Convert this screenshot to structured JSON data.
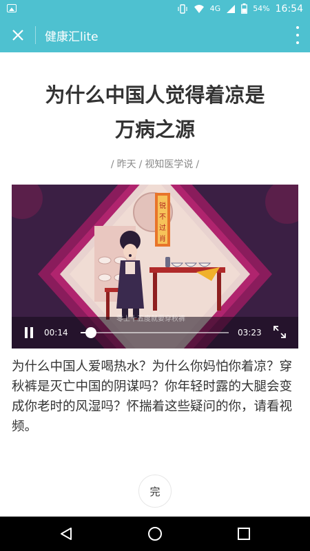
{
  "status_bar": {
    "network": "4G",
    "battery_percent": "54%",
    "time": "16:54"
  },
  "app_bar": {
    "title": "健康汇lite",
    "close_icon": "close-icon",
    "more_icon": "more-vert-icon"
  },
  "article": {
    "title_line1": "为什么中国人觉得着凉是",
    "title_line2": "万病之源",
    "meta_date": "昨天",
    "meta_source": "视知医学说",
    "meta_sep": "/",
    "body": "为什么中国人爱喝热水？为什么你妈怕你着凉？穿秋裤是灭亡中国的阴谋吗？你年轻时露的大腿会变成你老时的风湿吗？怀揣着这些疑问的你，请看视频。"
  },
  "video": {
    "banner_text": "锐不过肖",
    "subtitle": "零上十五度就要穿秋裤",
    "current_time": "00:14",
    "duration": "03:23",
    "progress": 0.07
  },
  "done_label": "完",
  "colors": {
    "accent": "#4ec1d0",
    "video_bg": "#3b1f44",
    "diamond": "#8a1c5c",
    "banner": "#e8742a"
  }
}
